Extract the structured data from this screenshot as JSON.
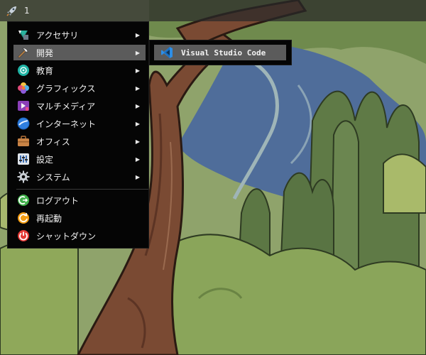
{
  "panel": {
    "workspace_number": "1"
  },
  "menu": {
    "items": [
      {
        "label": "アクセサリ",
        "icon": "accessories-icon",
        "has_submenu": true
      },
      {
        "label": "開発",
        "icon": "development-icon",
        "has_submenu": true,
        "active": true
      },
      {
        "label": "教育",
        "icon": "education-icon",
        "has_submenu": true
      },
      {
        "label": "グラフィックス",
        "icon": "graphics-icon",
        "has_submenu": true
      },
      {
        "label": "マルチメディア",
        "icon": "multimedia-icon",
        "has_submenu": true
      },
      {
        "label": "インターネット",
        "icon": "internet-icon",
        "has_submenu": true
      },
      {
        "label": "オフィス",
        "icon": "office-icon",
        "has_submenu": true
      },
      {
        "label": "設定",
        "icon": "settings-icon",
        "has_submenu": true
      },
      {
        "label": "システム",
        "icon": "system-icon",
        "has_submenu": true
      }
    ],
    "session": [
      {
        "label": "ログアウト",
        "icon": "logout-icon"
      },
      {
        "label": "再起動",
        "icon": "reboot-icon"
      },
      {
        "label": "シャットダウン",
        "icon": "shutdown-icon"
      }
    ],
    "submenu_arrow": "▶"
  },
  "submenu": {
    "items": [
      {
        "label": "Visual Studio Code",
        "icon": "vscode-icon"
      }
    ]
  },
  "colors": {
    "menu_bg": "#050505",
    "highlight": "#5b5b5b",
    "vscode_blue": "#2d8ee6",
    "logout_green": "#3fae49",
    "reboot_orange": "#f39c12",
    "shutdown_red": "#e53935"
  }
}
